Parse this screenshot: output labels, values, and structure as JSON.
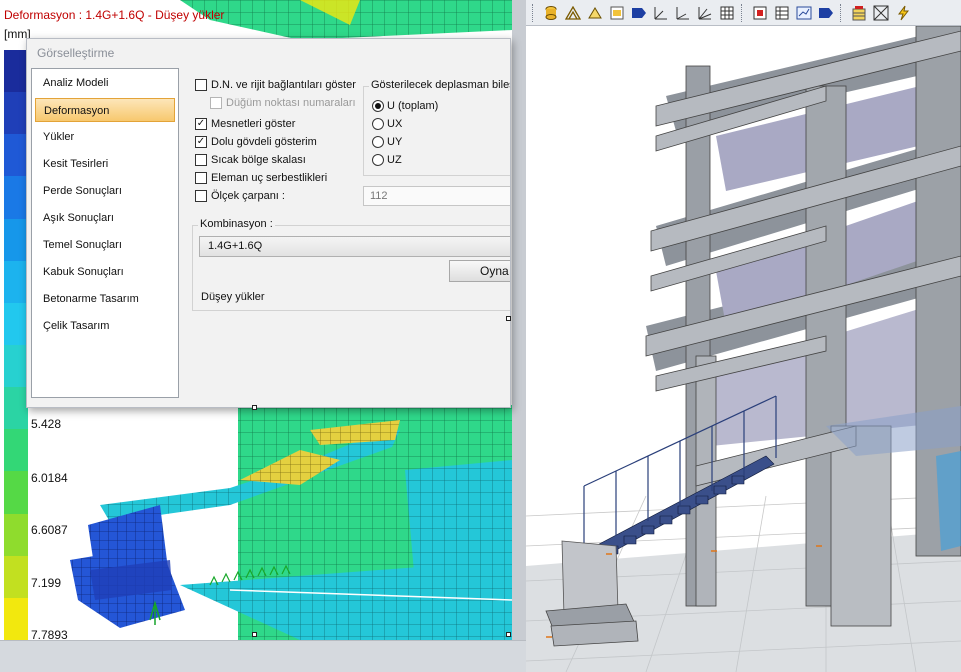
{
  "viewport": {
    "title": "Deformasyon : 1.4G+1.6Q  -  Düşey yükler",
    "unit": "[mm]",
    "legend_labels": [
      "5.428",
      "6.0184",
      "6.6087",
      "7.199",
      "7.7893"
    ],
    "legend_colors": [
      "#1a2c9c",
      "#1f3fb8",
      "#1f59d6",
      "#1a79e6",
      "#1697ea",
      "#1cb3ee",
      "#22c8ee",
      "#27d1d0",
      "#2bd4a4",
      "#33d776",
      "#55d946",
      "#8fdc2d",
      "#c2e020",
      "#f2e80e"
    ]
  },
  "dialog": {
    "title": "Görselleştirme",
    "nav": [
      {
        "label": "Analiz Modeli",
        "active": false
      },
      {
        "label": "Deformasyon",
        "active": true
      },
      {
        "label": "Yükler",
        "active": false
      },
      {
        "label": "Kesit Tesirleri",
        "active": false
      },
      {
        "label": "Perde Sonuçları",
        "active": false
      },
      {
        "label": "Aşık Sonuçları",
        "active": false
      },
      {
        "label": "Temel Sonuçları",
        "active": false
      },
      {
        "label": "Kabuk Sonuçları",
        "active": false
      },
      {
        "label": "Betonarme Tasarım",
        "active": false
      },
      {
        "label": "Çelik Tasarım",
        "active": false
      }
    ],
    "options": {
      "dn_rigid": {
        "label": "D.N. ve rijit bağlantıları göster",
        "checked": false
      },
      "node_numbers": {
        "label": "Düğüm noktası numaraları",
        "checked": false,
        "disabled": true
      },
      "supports": {
        "label": "Mesnetleri göster",
        "checked": true
      },
      "solid_view": {
        "label": "Dolu gövdeli gösterim",
        "checked": true
      },
      "hot_zone": {
        "label": "Sıcak bölge skalası",
        "checked": false
      },
      "end_releases": {
        "label": "Eleman uç serbestlikleri",
        "checked": false
      },
      "scale_factor": {
        "label": "Ölçek çarpanı :",
        "checked": false,
        "value": "112"
      }
    },
    "displacement": {
      "title": "Gösterilecek deplasman bileş",
      "options": [
        {
          "label": "U (toplam)",
          "selected": true
        },
        {
          "label": "UX",
          "selected": false
        },
        {
          "label": "UY",
          "selected": false
        },
        {
          "label": "UZ",
          "selected": false
        }
      ]
    },
    "combination": {
      "label": "Kombinasyon :",
      "value": "1.4G+1.6Q",
      "play_button": "Oyna",
      "description": "Düşey yükler"
    }
  },
  "toolbar": {
    "icons": [
      "cylinder-icon",
      "truss-icon",
      "section-icon",
      "solid-color-icon",
      "pentagon-icon",
      "axis-icon",
      "axis-alt-icon",
      "axis-multi-icon",
      "grid-icon",
      "node-icon",
      "table-icon",
      "chart-icon",
      "tag-icon",
      "building-icon",
      "frame-icon",
      "lightning-icon"
    ]
  }
}
